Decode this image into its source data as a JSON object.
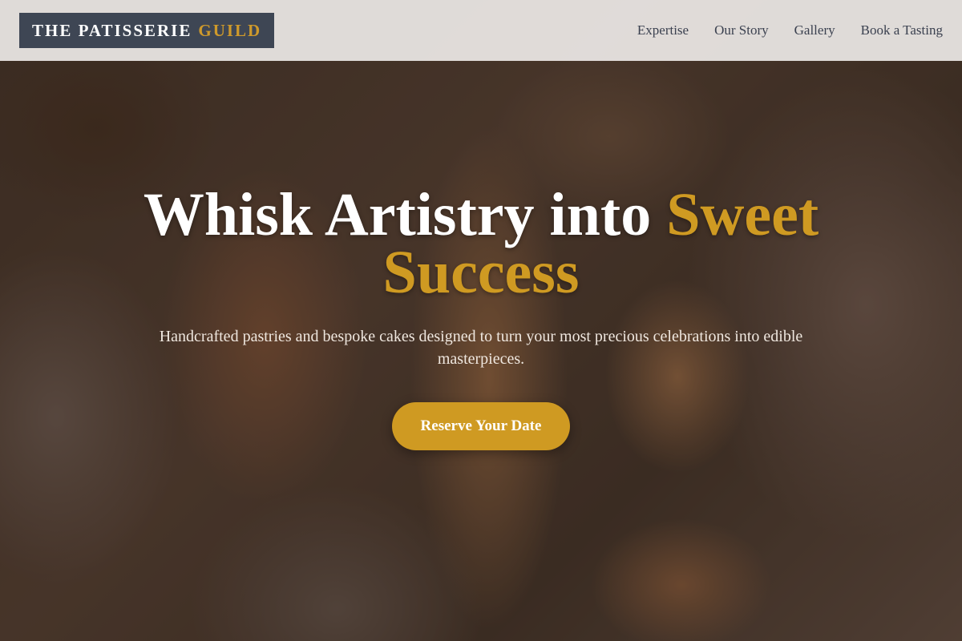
{
  "brand": {
    "name": "THE PATISSERIE",
    "accent": "GUILD"
  },
  "nav": {
    "items": [
      {
        "label": "Expertise"
      },
      {
        "label": "Our Story"
      },
      {
        "label": "Gallery"
      },
      {
        "label": "Book a Tasting"
      }
    ]
  },
  "hero": {
    "headline_main": "Whisk Artistry into",
    "headline_accent": "Sweet Success",
    "subtitle": "Handcrafted pastries and bespoke cakes designed to turn your most precious celebrations into edible masterpieces.",
    "cta_label": "Reserve Your Date"
  },
  "colors": {
    "accent": "#cf9a22",
    "logo_background": "#3e4654",
    "header_background": "#ece8e6",
    "nav_text": "#3b4150"
  }
}
